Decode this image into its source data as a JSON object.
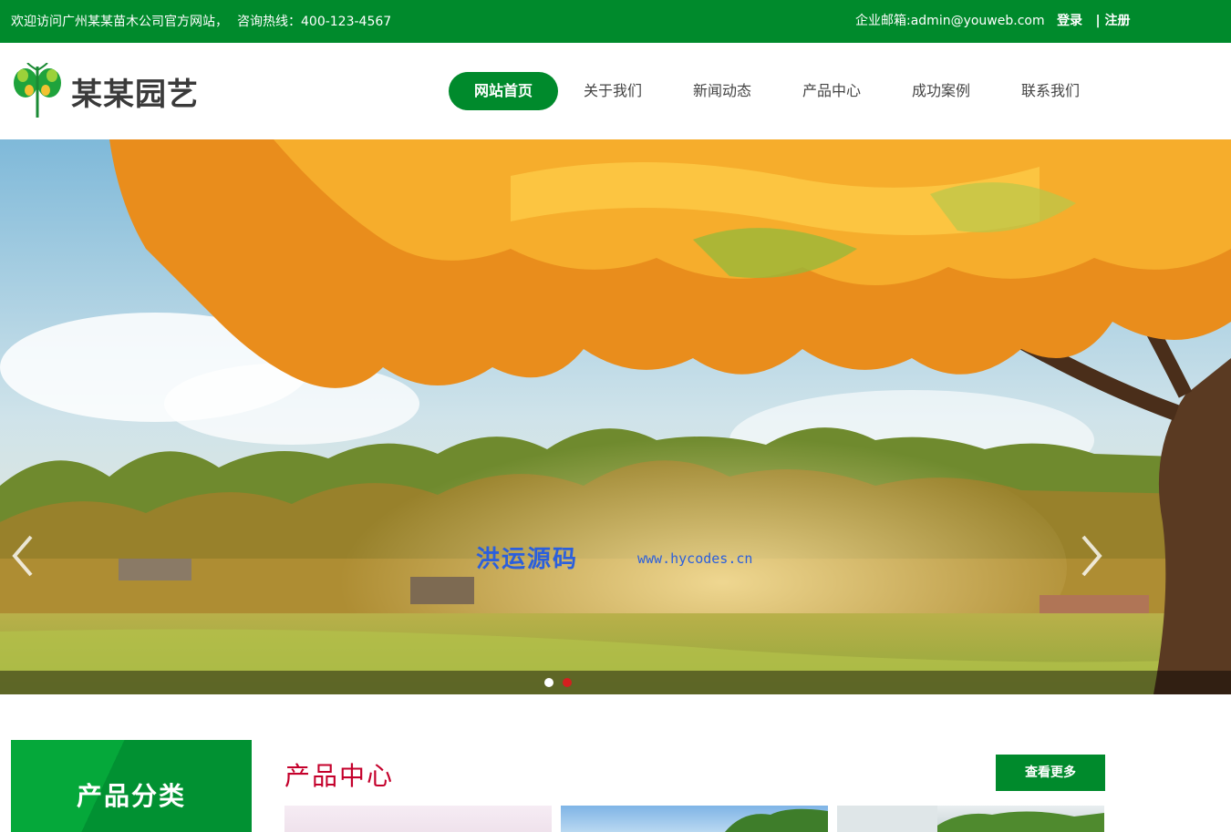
{
  "topbar": {
    "welcome": "欢迎访问广州某某苗木公司官方网站，",
    "hotline": "咨询热线：400-123-4567",
    "email": "企业邮箱:admin@youweb.com",
    "login": "登录",
    "register": "| 注册"
  },
  "header": {
    "logo_text": "某某园艺",
    "logo_icon": "butterfly-leaf-logo"
  },
  "nav": {
    "items": [
      {
        "label": "网站首页",
        "active": true
      },
      {
        "label": "关于我们",
        "active": false
      },
      {
        "label": "新闻动态",
        "active": false
      },
      {
        "label": "产品中心",
        "active": false
      },
      {
        "label": "成功案例",
        "active": false
      },
      {
        "label": "联系我们",
        "active": false
      }
    ]
  },
  "banner": {
    "watermark_cn": "洪运源码",
    "watermark_en": "www.hycodes.cn",
    "prev_icon": "chevron-left-icon",
    "next_icon": "chevron-right-icon",
    "slides_count": 2,
    "active_slide": 2
  },
  "sidebar": {
    "category_title": "产品分类"
  },
  "products": {
    "title": "产品中心",
    "more_label": "查看更多"
  },
  "colors": {
    "brand_green": "#008a2c",
    "product_title_red": "#c4002b",
    "dot_active": "#d41f1f"
  }
}
